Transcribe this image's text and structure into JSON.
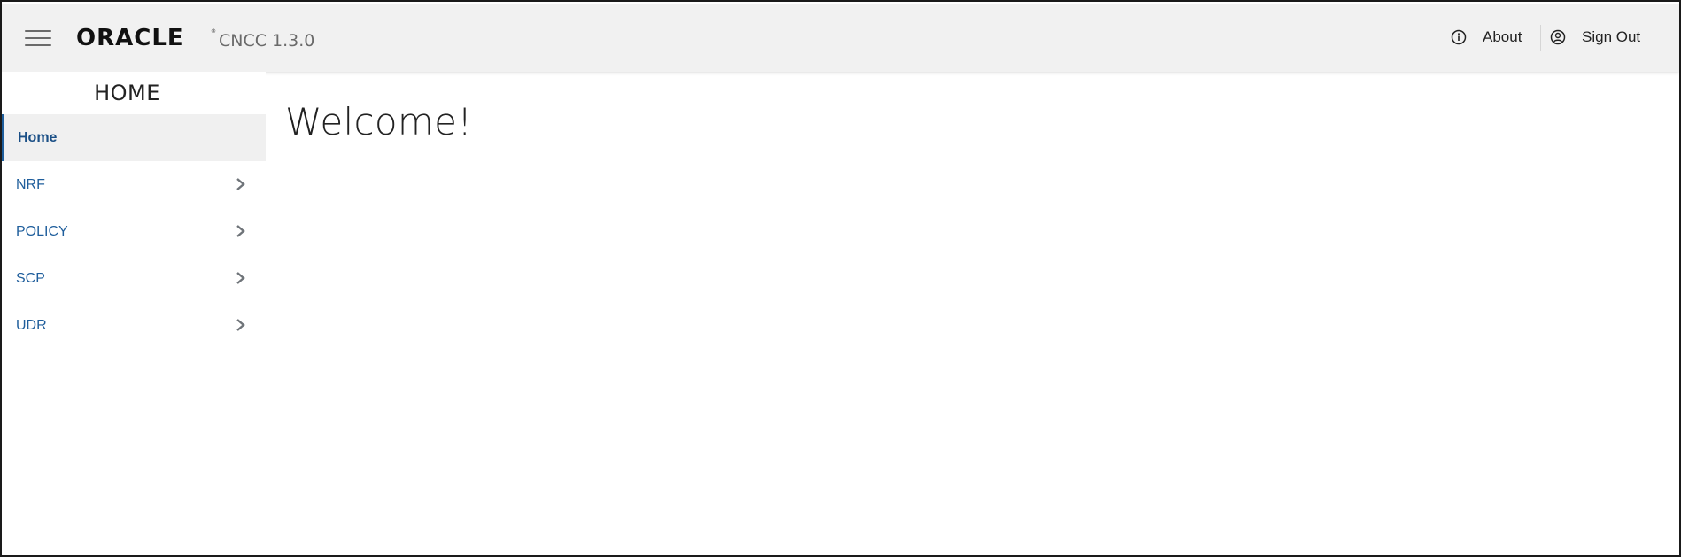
{
  "header": {
    "brand": "ORACLE",
    "app_name": "CNCC 1.3.0",
    "about_label": "About",
    "signout_label": "Sign Out"
  },
  "sidebar": {
    "title": "HOME",
    "items": [
      {
        "label": "Home",
        "active": true,
        "has_children": false
      },
      {
        "label": "NRF",
        "active": false,
        "has_children": true
      },
      {
        "label": "POLICY",
        "active": false,
        "has_children": true
      },
      {
        "label": "SCP",
        "active": false,
        "has_children": true
      },
      {
        "label": "UDR",
        "active": false,
        "has_children": true
      }
    ]
  },
  "main": {
    "heading": "Welcome!"
  },
  "colors": {
    "header_bg": "#f1f1f1",
    "link": "#1f5e9c",
    "active_bg": "#f0f0f0"
  }
}
